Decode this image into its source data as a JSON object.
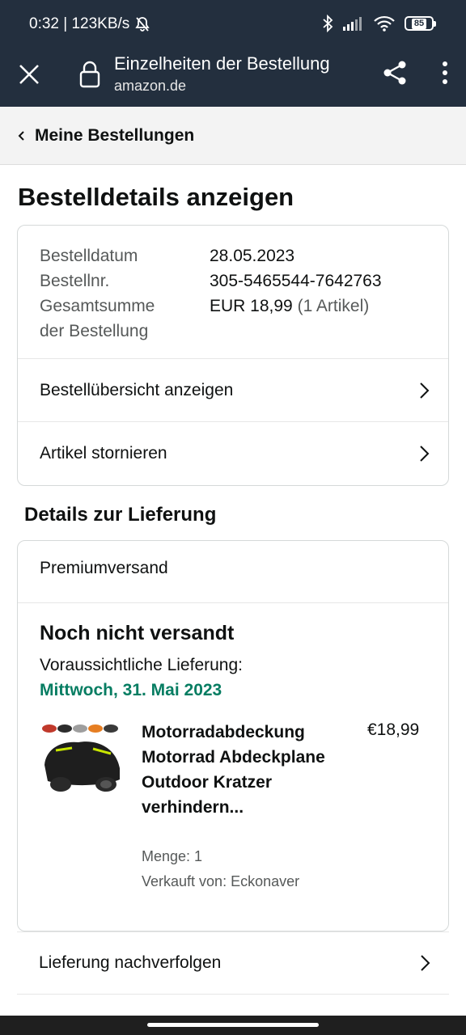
{
  "status_bar": {
    "time_speed": "0:32 | 123KB/s",
    "battery": "85"
  },
  "app_bar": {
    "title": "Einzelheiten der Bestellung",
    "url": "amazon.de"
  },
  "breadcrumb": {
    "label": "Meine Bestellungen"
  },
  "page": {
    "title": "Bestelldetails anzeigen"
  },
  "order": {
    "date_label": "Bestelldatum",
    "date_value": "28.05.2023",
    "number_label": "Bestellnr.",
    "number_value": "305-5465544-7642763",
    "total_label_1": "Gesamtsumme",
    "total_label_2": "der Bestellung",
    "total_value": "EUR 18,99",
    "total_items": "(1 Artikel)"
  },
  "actions": {
    "summary": "Bestellübersicht anzeigen",
    "cancel": "Artikel stornieren"
  },
  "delivery": {
    "section_title": "Details zur Lieferung",
    "ship_type": "Premiumversand",
    "status": "Noch nicht versandt",
    "eta_label": "Voraussichtliche Lieferung:",
    "eta_date": "Mittwoch, 31. Mai 2023",
    "product": {
      "name": "Motorradabdeckung Motorrad Abdeckplane Outdoor Kratzer verhindern...",
      "price": "€18,99",
      "quantity": "Menge: 1",
      "seller": "Verkauft von: Eckonaver"
    },
    "track": "Lieferung nachverfolgen"
  },
  "colors": {
    "header": "#232f3e",
    "eta": "#067d62",
    "muted": "#565959"
  }
}
